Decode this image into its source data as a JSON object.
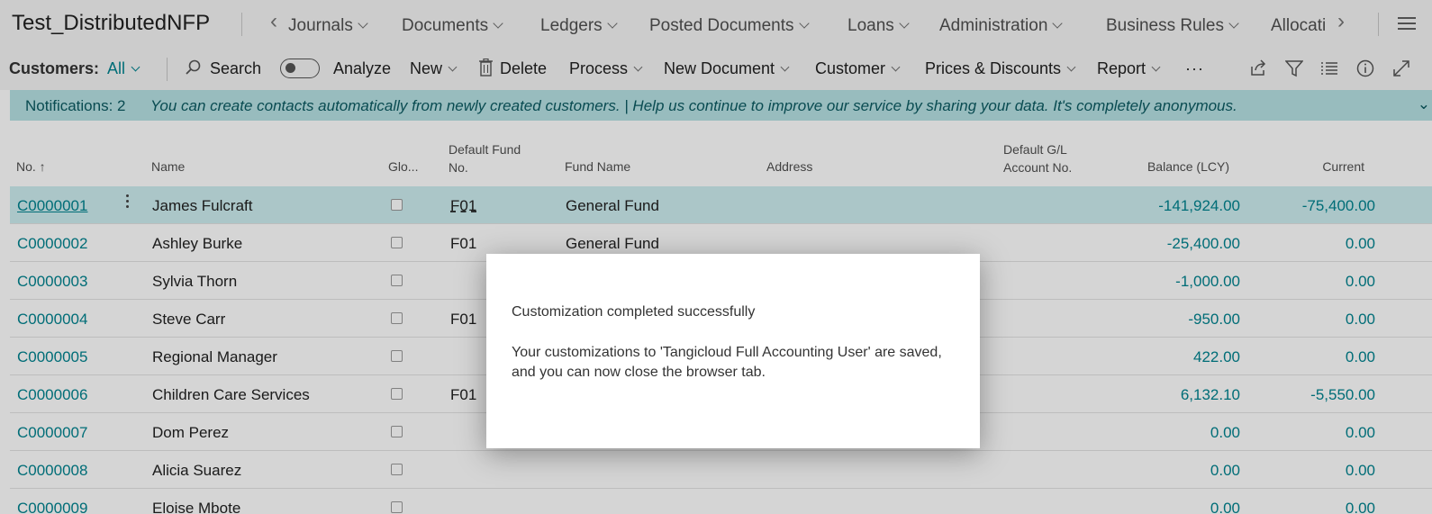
{
  "app": {
    "company": "Test_DistributedNFP"
  },
  "nav": {
    "items": [
      "Journals",
      "Documents",
      "Ledgers",
      "Posted Documents",
      "Loans",
      "Administration",
      "Business Rules",
      "Allocati"
    ]
  },
  "actions": {
    "page_label": "Customers:",
    "filter_value": "All",
    "search": "Search",
    "analyze": "Analyze",
    "new": "New",
    "delete": "Delete",
    "process": "Process",
    "new_document": "New Document",
    "customer": "Customer",
    "prices_discounts": "Prices & Discounts",
    "report": "Report",
    "more": "···",
    "analyze_toggle_on": false
  },
  "notification": {
    "count": "Notifications: 2",
    "message": "You can create contacts automatically from newly created customers.  |  Help us continue to improve our service by sharing your data. It's completely anonymous."
  },
  "table": {
    "headers": {
      "no": "No. ↑",
      "name": "Name",
      "glo": "Glo...",
      "default_fund_l1": "Default Fund",
      "default_fund_l2": "No.",
      "fund_name": "Fund Name",
      "address": "Address",
      "gl_l1": "Default G/L",
      "gl_l2": "Account No.",
      "balance": "Balance (LCY)",
      "current": "Current"
    },
    "rows": [
      {
        "no": "C0000001",
        "name": "James Fulcraft",
        "fund": "F01",
        "fund_name": "General Fund",
        "balance": "-141,924.00",
        "current": "-75,400.00"
      },
      {
        "no": "C0000002",
        "name": "Ashley Burke",
        "fund": "F01",
        "fund_name": "General Fund",
        "balance": "-25,400.00",
        "current": "0.00"
      },
      {
        "no": "C0000003",
        "name": "Sylvia Thorn",
        "fund": "",
        "fund_name": "",
        "balance": "-1,000.00",
        "current": "0.00"
      },
      {
        "no": "C0000004",
        "name": "Steve Carr",
        "fund": "F01",
        "fund_name": "",
        "balance": "-950.00",
        "current": "0.00"
      },
      {
        "no": "C0000005",
        "name": "Regional Manager",
        "fund": "",
        "fund_name": "",
        "balance": "422.00",
        "current": "0.00"
      },
      {
        "no": "C0000006",
        "name": "Children Care Services",
        "fund": "F01",
        "fund_name": "",
        "balance": "6,132.10",
        "current": "-5,550.00"
      },
      {
        "no": "C0000007",
        "name": "Dom Perez",
        "fund": "",
        "fund_name": "",
        "balance": "0.00",
        "current": "0.00"
      },
      {
        "no": "C0000008",
        "name": "Alicia Suarez",
        "fund": "",
        "fund_name": "",
        "balance": "0.00",
        "current": "0.00"
      },
      {
        "no": "C0000009",
        "name": "Eloise Mbote",
        "fund": "",
        "fund_name": "",
        "balance": "0.00",
        "current": "0.00"
      }
    ]
  },
  "dialog": {
    "title": "Customization completed successfully",
    "message": "Your customizations to 'Tangicloud Full Accounting User' are saved, and you can now close the browser tab."
  },
  "colors": {
    "accent": "#00838f",
    "notification_bg": "#b6e1e4",
    "selected_row_bg": "#cdeef0"
  }
}
